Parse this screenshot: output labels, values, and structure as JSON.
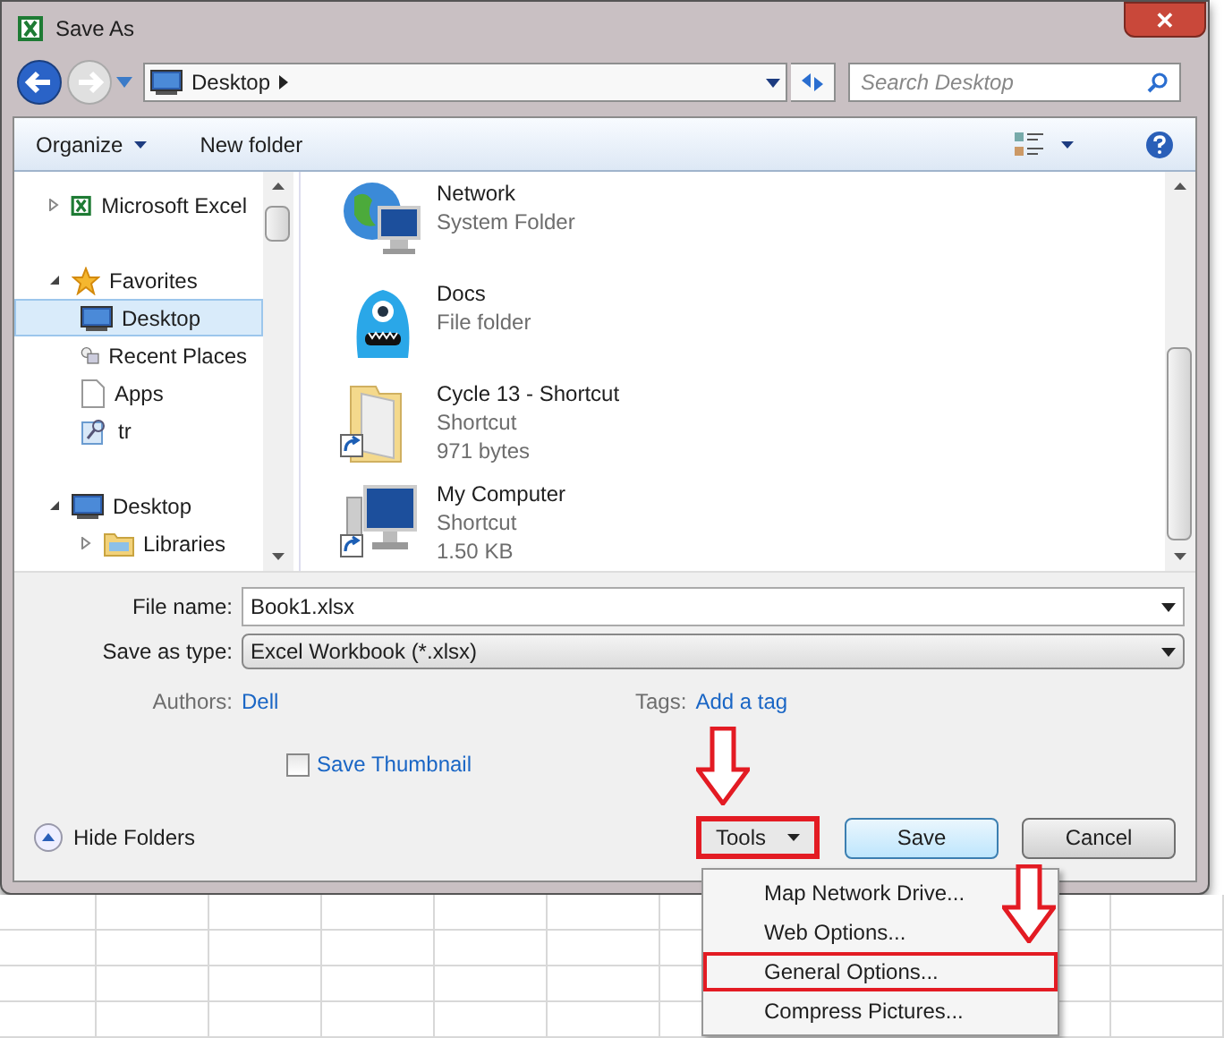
{
  "window": {
    "title": "Save As",
    "close": "✕"
  },
  "address": {
    "location": "Desktop",
    "search_placeholder": "Search Desktop"
  },
  "toolbar": {
    "organize": "Organize",
    "new_folder": "New folder"
  },
  "nav_tree": [
    {
      "label": "Microsoft Excel",
      "kind": "excel",
      "expanded": false,
      "selected": false
    },
    {
      "label": "Favorites",
      "kind": "star",
      "expanded": true,
      "selected": false,
      "children": [
        {
          "label": "Desktop",
          "kind": "desktop",
          "selected": true
        },
        {
          "label": "Recent Places",
          "kind": "recent",
          "selected": false
        },
        {
          "label": "Apps",
          "kind": "file",
          "selected": false
        },
        {
          "label": "tr",
          "kind": "tool",
          "selected": false
        }
      ]
    },
    {
      "label": "Desktop",
      "kind": "desktop",
      "expanded": true,
      "selected": false,
      "children": [
        {
          "label": "Libraries",
          "kind": "library",
          "expanded": false,
          "selected": false
        }
      ]
    }
  ],
  "files": [
    {
      "name": "Network",
      "kind": "network",
      "lines": [
        "System Folder"
      ]
    },
    {
      "name": "Docs",
      "kind": "monster",
      "lines": [
        "File folder"
      ]
    },
    {
      "name": "Cycle 13 - Shortcut",
      "kind": "folder-shortcut",
      "lines": [
        "Shortcut",
        "971 bytes"
      ]
    },
    {
      "name": "My Computer",
      "kind": "computer-shortcut",
      "lines": [
        "Shortcut",
        "1.50 KB"
      ]
    }
  ],
  "form": {
    "file_name_label": "File name:",
    "file_name": "Book1.xlsx",
    "type_label": "Save as type:",
    "type": "Excel Workbook (*.xlsx)",
    "authors_label": "Authors:",
    "authors": "Dell",
    "tags_label": "Tags:",
    "tags": "Add a tag",
    "thumbnail": {
      "label": "Save Thumbnail",
      "checked": false
    }
  },
  "hide_folders": "Hide Folders",
  "buttons": {
    "tools": {
      "label": "Tools",
      "annotated": true
    },
    "save": "Save",
    "cancel": "Cancel"
  },
  "tools_menu": [
    {
      "label": "Map Network Drive...",
      "annotated": false
    },
    {
      "label": "Web Options...",
      "annotated": false
    },
    {
      "label": "General Options...",
      "annotated": true
    },
    {
      "label": "Compress Pictures...",
      "annotated": false
    }
  ]
}
